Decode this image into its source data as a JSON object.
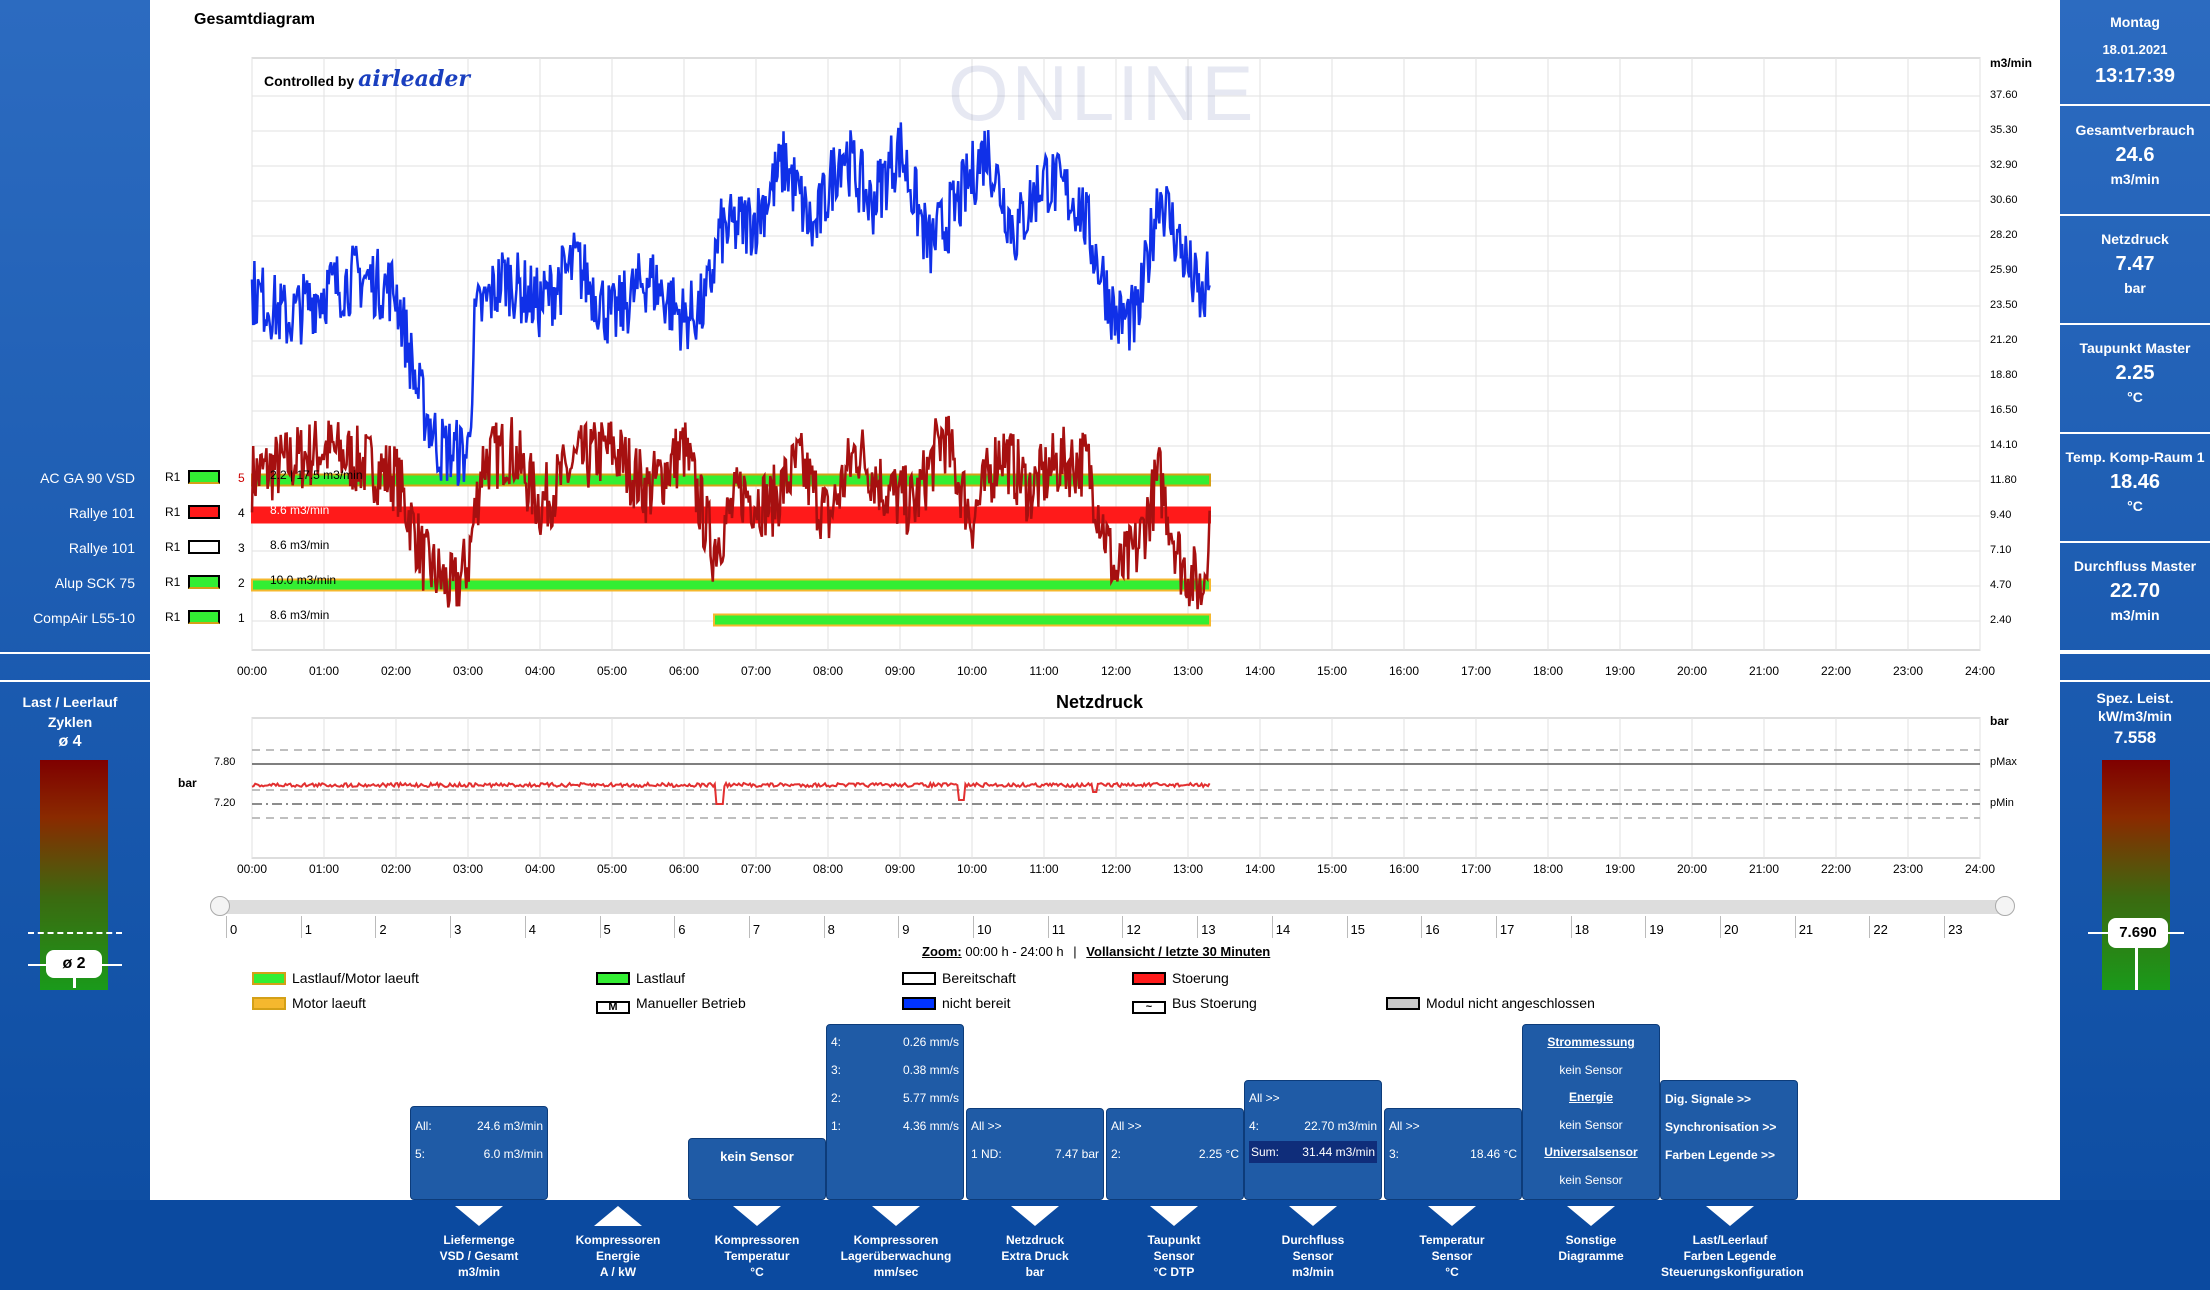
{
  "page_title": "Gesamtdiagram",
  "brand": {
    "prefix": "Controlled by",
    "name": "airleader"
  },
  "watermark": "ONLINE",
  "main_chart": {
    "unit": "m3/min",
    "y_ticks": [
      "37.60",
      "35.30",
      "32.90",
      "30.60",
      "28.20",
      "25.90",
      "23.50",
      "21.20",
      "18.80",
      "16.50",
      "14.10",
      "11.80",
      "9.40",
      "7.10",
      "4.70",
      "2.40"
    ],
    "x_ticks": [
      "00:00",
      "01:00",
      "02:00",
      "03:00",
      "04:00",
      "05:00",
      "06:00",
      "07:00",
      "08:00",
      "09:00",
      "10:00",
      "11:00",
      "12:00",
      "13:00",
      "14:00",
      "15:00",
      "16:00",
      "17:00",
      "18:00",
      "19:00",
      "20:00",
      "21:00",
      "22:00",
      "23:00",
      "24:00"
    ]
  },
  "compressors": [
    {
      "name": "AC GA 90 VSD",
      "r": "R1",
      "num": "5",
      "value": "2.2 | 17.5 m3/min",
      "color": "#33ee33"
    },
    {
      "name": "Rallye 101",
      "r": "R1",
      "num": "4",
      "value": "8.6 m3/min",
      "color": "#ff1a1a"
    },
    {
      "name": "Rallye 101",
      "r": "R1",
      "num": "3",
      "value": "8.6 m3/min",
      "color": "#ffffff"
    },
    {
      "name": "Alup SCK 75",
      "r": "R1",
      "num": "2",
      "value": "10.0 m3/min",
      "color": "#33ee33"
    },
    {
      "name": "CompAir L55-10",
      "r": "R1",
      "num": "1",
      "value": "8.6 m3/min",
      "color": "#33ee33"
    }
  ],
  "pressure_chart": {
    "title": "Netzdruck",
    "unit_left": "bar",
    "unit_right": "bar",
    "y_ticks": [
      "7.80",
      "7.20"
    ],
    "right_labels": [
      "pMax",
      "pMin"
    ]
  },
  "slider": {
    "ticks": [
      "0",
      "1",
      "2",
      "3",
      "4",
      "5",
      "6",
      "7",
      "8",
      "9",
      "10",
      "11",
      "12",
      "13",
      "14",
      "15",
      "16",
      "17",
      "18",
      "19",
      "20",
      "21",
      "22",
      "23"
    ],
    "zoom_label": "Zoom:",
    "zoom_value": "00:00 h - 24:00 h",
    "separator": "|",
    "full_view_link": "Vollansicht / letzte 30 Minuten"
  },
  "legend": [
    {
      "label": "Lastlauf/Motor laeuft",
      "fill": "#33ee33",
      "border": "#d4a017"
    },
    {
      "label": "Motor laeuft",
      "fill": "#f5b82e",
      "border": "#d4a017"
    },
    {
      "label": "Lastlauf",
      "fill": "#33ee33",
      "border": "#000"
    },
    {
      "label": "Manueller Betrieb",
      "fill": "#fff",
      "border": "#000",
      "mark": "M"
    },
    {
      "label": "Bereitschaft",
      "fill": "#fff",
      "border": "#000"
    },
    {
      "label": "nicht bereit",
      "fill": "#0033ff",
      "border": "#000"
    },
    {
      "label": "Stoerung",
      "fill": "#ff1a1a",
      "border": "#000"
    },
    {
      "label": "Bus Stoerung",
      "fill": "#fff",
      "border": "#000",
      "mark": "~"
    },
    {
      "label": "Modul nicht angeschlossen",
      "fill": "#c8c8c8",
      "border": "#000"
    }
  ],
  "left_panel": {
    "title_line1": "Last / Leerlauf",
    "title_line2": "Zyklen",
    "avg_top": "ø 4",
    "avg_value": "ø 2"
  },
  "right_panel": {
    "day": "Montag",
    "date": "18.01.2021",
    "time": "13:17:39",
    "tiles": [
      {
        "label": "Gesamtverbrauch",
        "value": "24.6",
        "unit": "m3/min"
      },
      {
        "label": "Netzdruck",
        "value": "7.47",
        "unit": "bar"
      },
      {
        "label": "Taupunkt Master",
        "value": "2.25",
        "unit": "°C"
      },
      {
        "label": "Temp. Komp-Raum 1",
        "value": "18.46",
        "unit": "°C"
      },
      {
        "label": "Durchfluss Master",
        "value": "22.70",
        "unit": "m3/min"
      }
    ],
    "spez_line1": "Spez. Leist.",
    "spez_line2": "kW/m3/min",
    "spez_value": "7.558",
    "spez_marker": "7.690"
  },
  "boxes": {
    "liefermenge": {
      "r1_l": "All:",
      "r1_v": "24.6 m3/min",
      "r2_l": "5:",
      "r2_v": "6.0 m3/min"
    },
    "kompressoren_temp": {
      "text": "kein Sensor"
    },
    "lager": {
      "r1_l": "4:",
      "r1_v": "0.26 mm/s",
      "r2_l": "3:",
      "r2_v": "0.38 mm/s",
      "r3_l": "2:",
      "r3_v": "5.77 mm/s",
      "r4_l": "1:",
      "r4_v": "4.36 mm/s"
    },
    "netzdruck": {
      "head": "All >>",
      "r1_l": "1 ND:",
      "r1_v": "7.47 bar"
    },
    "taupunkt": {
      "head": "All >>",
      "r1_l": "2:",
      "r1_v": "2.25 °C"
    },
    "durchfluss": {
      "head": "All >>",
      "r1_l": "4:",
      "r1_v": "22.70 m3/min",
      "r2_l": "Sum:",
      "r2_v": "31.44 m3/min"
    },
    "temperatur": {
      "head": "All >>",
      "r1_l": "3:",
      "r1_v": "18.46 °C"
    },
    "sonstige": {
      "l1": "Strommessung",
      "l2": "kein Sensor",
      "l3": "Energie",
      "l4": "kein Sensor",
      "l5": "Universalsensor",
      "l6": "kein Sensor"
    },
    "config": {
      "l1": "Dig. Signale >>",
      "l2": "Synchronisation >>",
      "l3": "Farben Legende >>"
    }
  },
  "bottom_nav": [
    {
      "l1": "Liefermenge",
      "l2": "VSD / Gesamt",
      "l3": "m3/min"
    },
    {
      "l1": "Kompressoren",
      "l2": "Energie",
      "l3": "A / kW"
    },
    {
      "l1": "Kompressoren",
      "l2": "Temperatur",
      "l3": "°C"
    },
    {
      "l1": "Kompressoren",
      "l2": "Lagerüberwachung",
      "l3": "mm/sec"
    },
    {
      "l1": "Netzdruck",
      "l2": "Extra Druck",
      "l3": "bar"
    },
    {
      "l1": "Taupunkt",
      "l2": "Sensor",
      "l3": "°C DTP"
    },
    {
      "l1": "Durchfluss",
      "l2": "Sensor",
      "l3": "m3/min"
    },
    {
      "l1": "Temperatur",
      "l2": "Sensor",
      "l3": "°C"
    },
    {
      "l1": "Sonstige",
      "l2": "Diagramme",
      "l3": ""
    },
    {
      "l1": "Last/Leerlauf",
      "l2": "Farben Legende",
      "l3": "Steuerungskonfiguration"
    }
  ]
}
